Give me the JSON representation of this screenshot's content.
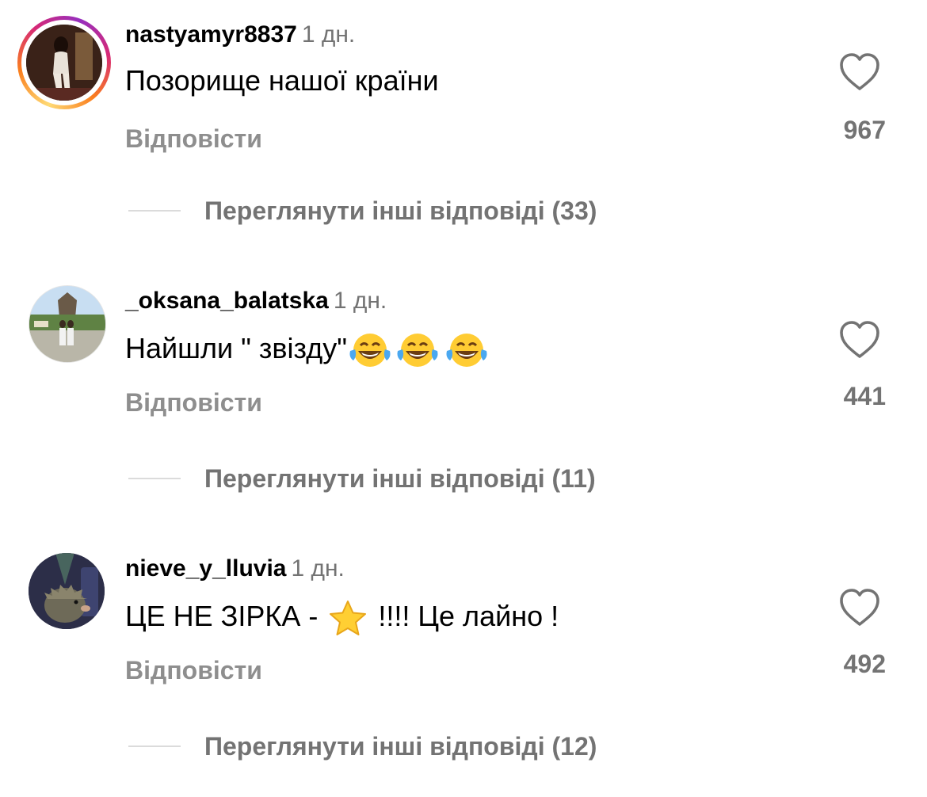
{
  "comments": [
    {
      "username": "nastyamyr8837",
      "time": "1 дн.",
      "text": "Позорище нашої країни",
      "reply_label": "Відповісти",
      "likes": "967",
      "view_replies": "Переглянути інші відповіді (33)",
      "has_story_ring": true
    },
    {
      "username": "_oksana_balatska",
      "time": "1 дн.",
      "text_before": "Найшли \" звізду\"",
      "emojis": [
        "tears-of-joy-emoji",
        "tears-of-joy-emoji",
        "tears-of-joy-emoji"
      ],
      "reply_label": "Відповісти",
      "likes": "441",
      "view_replies": "Переглянути інші відповіді (11)"
    },
    {
      "username": "nieve_y_lluvia",
      "time": "1 дн.",
      "text_before": "ЦЕ НЕ ЗІРКА - ",
      "emoji": "star-emoji",
      "text_after": " !!!! Це лайно !",
      "reply_label": "Відповісти",
      "likes": "492",
      "view_replies": "Переглянути інші відповіді (12)"
    }
  ],
  "colors": {
    "username": "#000000",
    "secondary_text": "#737373",
    "reply_label": "#8e8e8e",
    "divider": "#dbdbdb"
  },
  "icons": {
    "like": "heart-outline-icon"
  }
}
